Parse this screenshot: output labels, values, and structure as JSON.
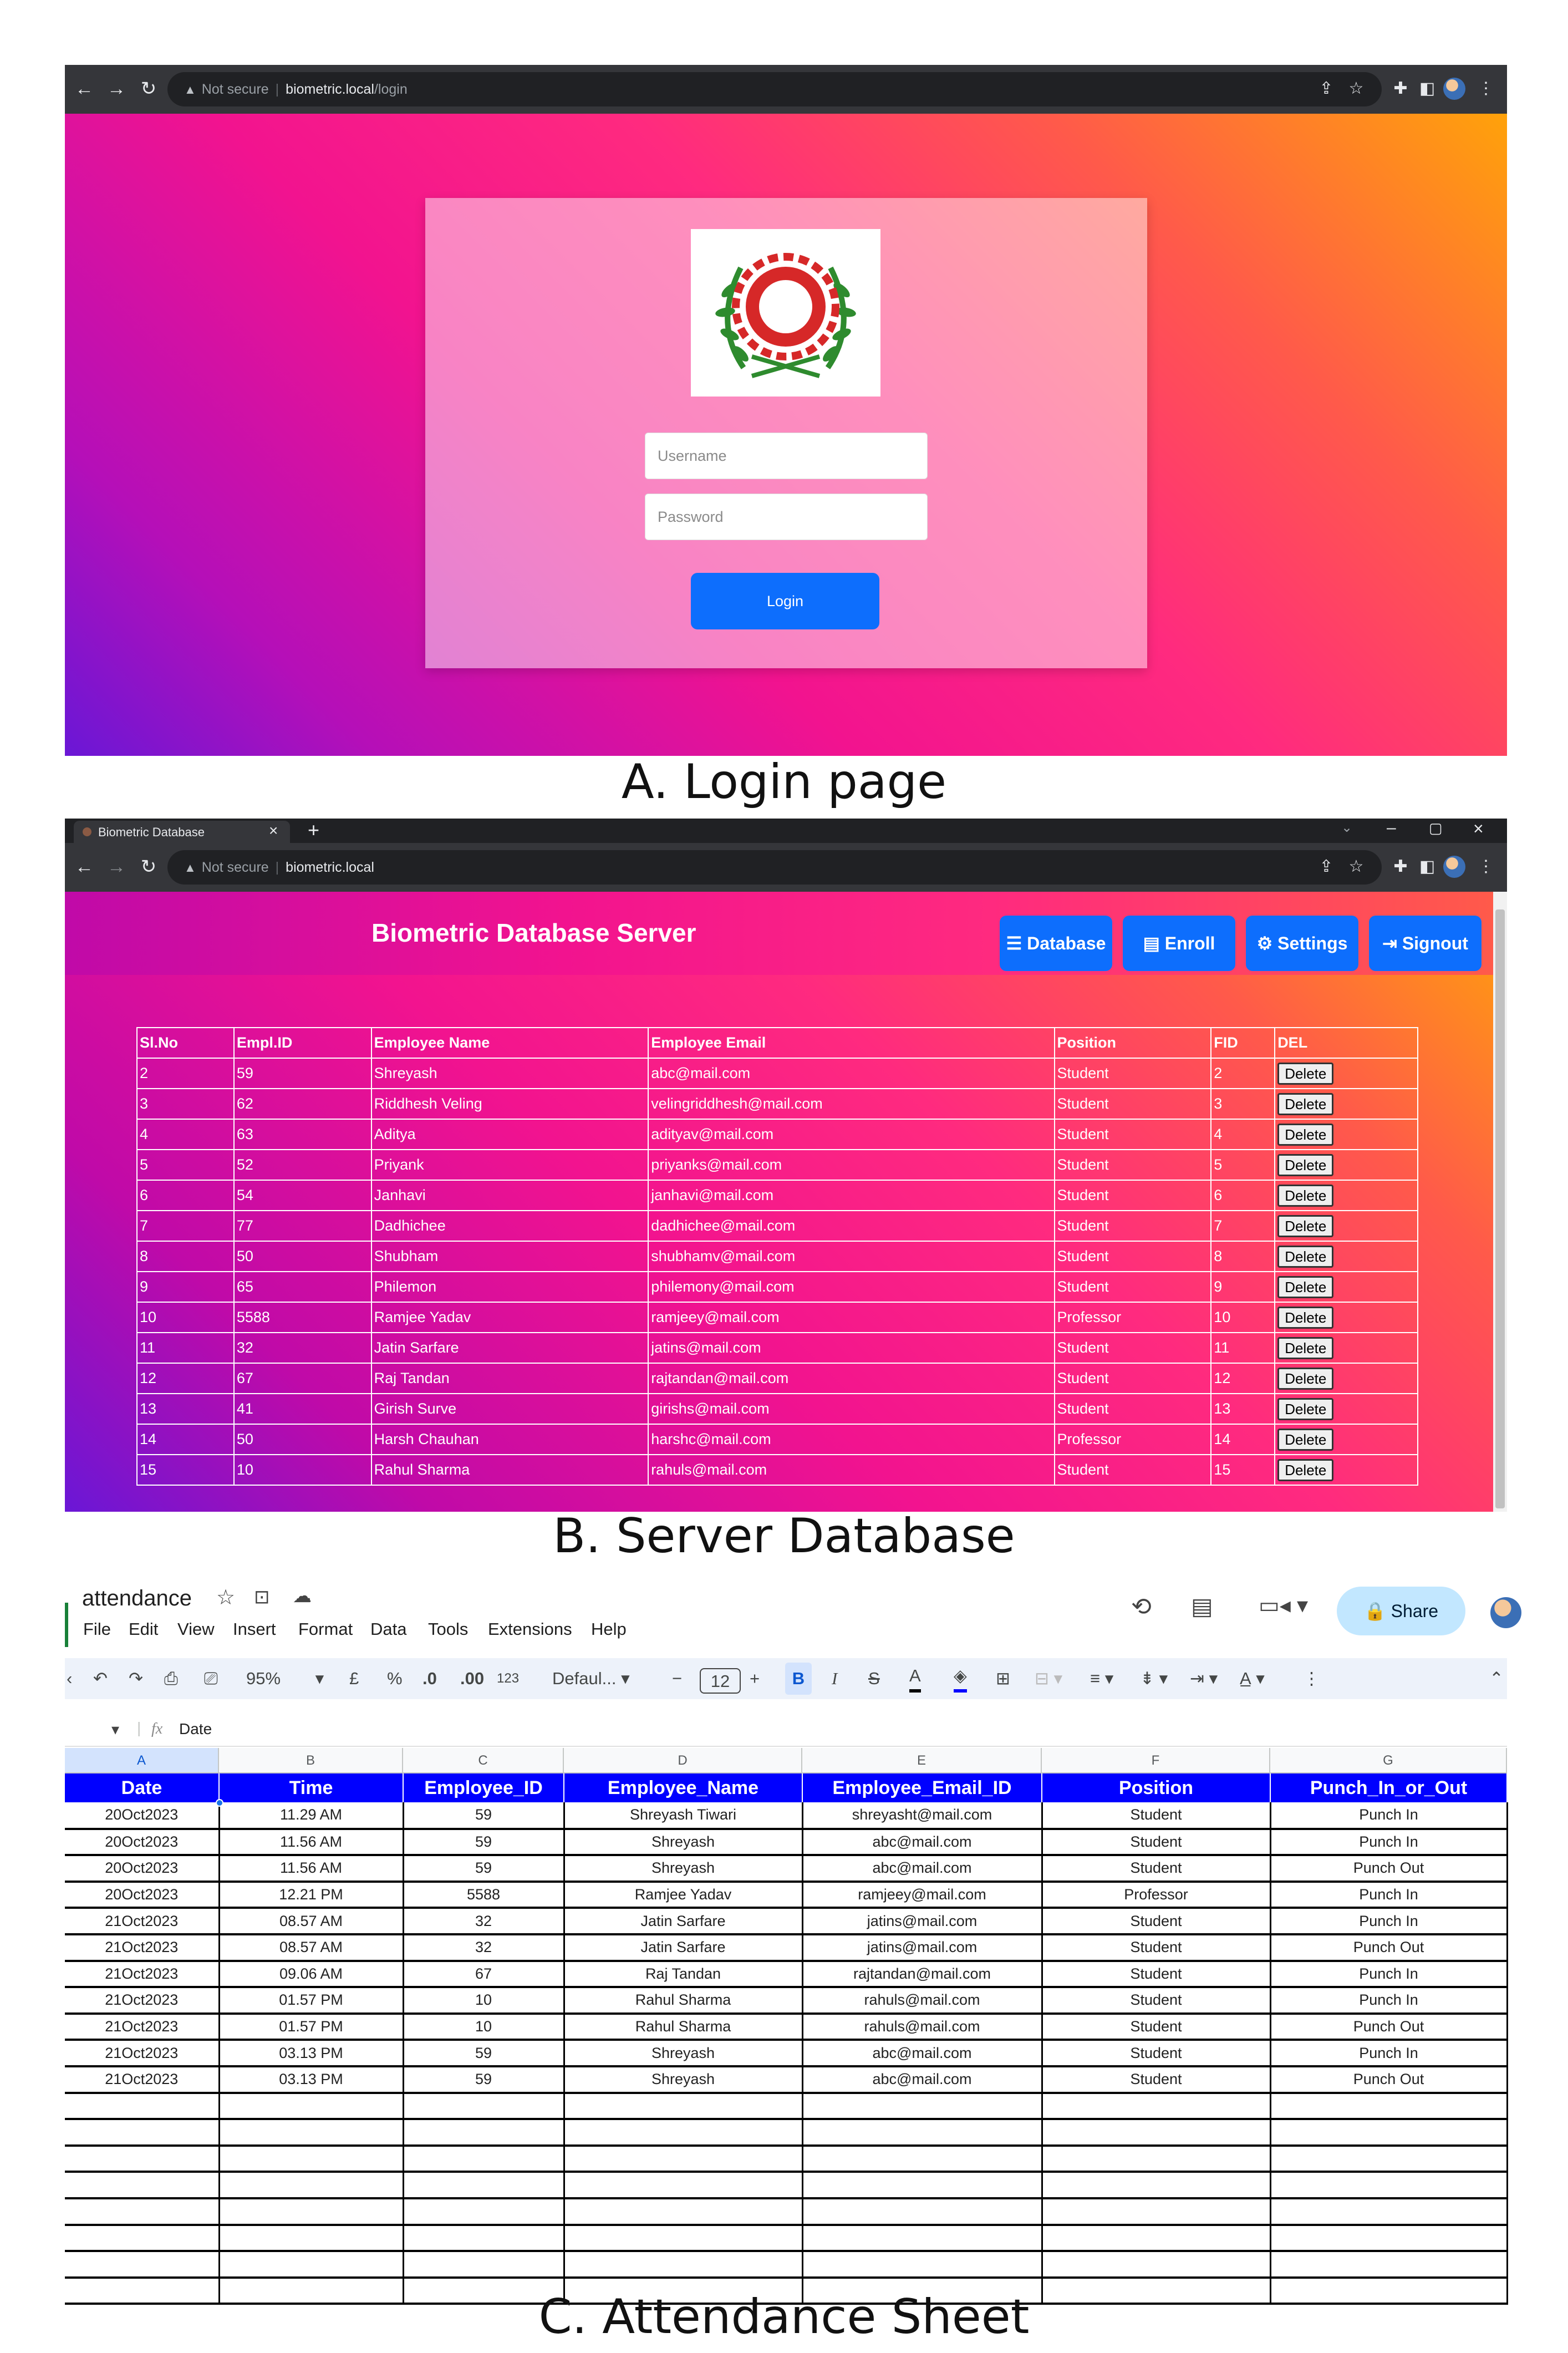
{
  "login_browser": {
    "not_secure": "Not secure",
    "host": "biometric.local",
    "path": "/login"
  },
  "login": {
    "username_placeholder": "Username",
    "password_placeholder": "Password",
    "login_label": "Login"
  },
  "caption_a": "A. Login page",
  "db_browser": {
    "tab_title": "Biometric Database",
    "not_secure": "Not secure",
    "host": "biometric.local"
  },
  "db": {
    "title": "Biometric Database Server",
    "nav": [
      "Database",
      "Enroll",
      "Settings",
      "Signout"
    ],
    "headers": [
      "Sl.No",
      "Empl.ID",
      "Employee Name",
      "Employee Email",
      "Position",
      "FID",
      "DEL"
    ],
    "delete_label": "Delete",
    "rows": [
      [
        "2",
        "59",
        "Shreyash",
        "abc@mail.com",
        "Student",
        "2"
      ],
      [
        "3",
        "62",
        "Riddhesh Veling",
        "velingriddhesh@mail.com",
        "Student",
        "3"
      ],
      [
        "4",
        "63",
        "Aditya",
        "adityav@mail.com",
        "Student",
        "4"
      ],
      [
        "5",
        "52",
        "Priyank",
        "priyanks@mail.com",
        "Student",
        "5"
      ],
      [
        "6",
        "54",
        "Janhavi",
        "janhavi@mail.com",
        "Student",
        "6"
      ],
      [
        "7",
        "77",
        "Dadhichee",
        "dadhichee@mail.com",
        "Student",
        "7"
      ],
      [
        "8",
        "50",
        "Shubham",
        "shubhamv@mail.com",
        "Student",
        "8"
      ],
      [
        "9",
        "65",
        "Philemon",
        "philemony@mail.com",
        "Student",
        "9"
      ],
      [
        "10",
        "5588",
        "Ramjee Yadav",
        "ramjeey@mail.com",
        "Professor",
        "10"
      ],
      [
        "11",
        "32",
        "Jatin Sarfare",
        "jatins@mail.com",
        "Student",
        "11"
      ],
      [
        "12",
        "67",
        "Raj Tandan",
        "rajtandan@mail.com",
        "Student",
        "12"
      ],
      [
        "13",
        "41",
        "Girish Surve",
        "girishs@mail.com",
        "Student",
        "13"
      ],
      [
        "14",
        "50",
        "Harsh Chauhan",
        "harshc@mail.com",
        "Professor",
        "14"
      ],
      [
        "15",
        "10",
        "Rahul Sharma",
        "rahuls@mail.com",
        "Student",
        "15"
      ]
    ]
  },
  "caption_b": "B. Server Database",
  "sheet": {
    "title": "attendance",
    "menu": [
      "File",
      "Edit",
      "View",
      "Insert",
      "Format",
      "Data",
      "Tools",
      "Extensions",
      "Help"
    ],
    "share_label": "Share",
    "zoom": "95%",
    "currency": "£",
    "percent": "%",
    "dec_decrease": ".0",
    "dec_increase": ".00",
    "number_fmt": "123",
    "font": "Defaul...",
    "font_size": "12",
    "formula_label": "fx",
    "formula_value": "Date",
    "col_letters": [
      "A",
      "B",
      "C",
      "D",
      "E",
      "F",
      "G"
    ],
    "headers": [
      "Date",
      "Time",
      "Employee_ID",
      "Employee_Name",
      "Employee_Email_ID",
      "Position",
      "Punch_In_or_Out"
    ],
    "rows": [
      [
        "20Oct2023",
        "11.29 AM",
        "59",
        "Shreyash Tiwari",
        "shreyasht@mail.com",
        "Student",
        "Punch In"
      ],
      [
        "20Oct2023",
        "11.56 AM",
        "59",
        "Shreyash",
        "abc@mail.com",
        "Student",
        "Punch In"
      ],
      [
        "20Oct2023",
        "11.56 AM",
        "59",
        "Shreyash",
        "abc@mail.com",
        "Student",
        "Punch Out"
      ],
      [
        "20Oct2023",
        "12.21 PM",
        "5588",
        "Ramjee Yadav",
        "ramjeey@mail.com",
        "Professor",
        "Punch In"
      ],
      [
        "21Oct2023",
        "08.57 AM",
        "32",
        "Jatin Sarfare",
        "jatins@mail.com",
        "Student",
        "Punch In"
      ],
      [
        "21Oct2023",
        "08.57 AM",
        "32",
        "Jatin Sarfare",
        "jatins@mail.com",
        "Student",
        "Punch Out"
      ],
      [
        "21Oct2023",
        "09.06 AM",
        "67",
        "Raj Tandan",
        "rajtandan@mail.com",
        "Student",
        "Punch In"
      ],
      [
        "21Oct2023",
        "01.57 PM",
        "10",
        "Rahul Sharma",
        "rahuls@mail.com",
        "Student",
        "Punch In"
      ],
      [
        "21Oct2023",
        "01.57 PM",
        "10",
        "Rahul Sharma",
        "rahuls@mail.com",
        "Student",
        "Punch Out"
      ],
      [
        "21Oct2023",
        "03.13 PM",
        "59",
        "Shreyash",
        "abc@mail.com",
        "Student",
        "Punch In"
      ],
      [
        "21Oct2023",
        "03.13 PM",
        "59",
        "Shreyash",
        "abc@mail.com",
        "Student",
        "Punch Out"
      ]
    ]
  },
  "caption_c": "C. Attendance Sheet"
}
